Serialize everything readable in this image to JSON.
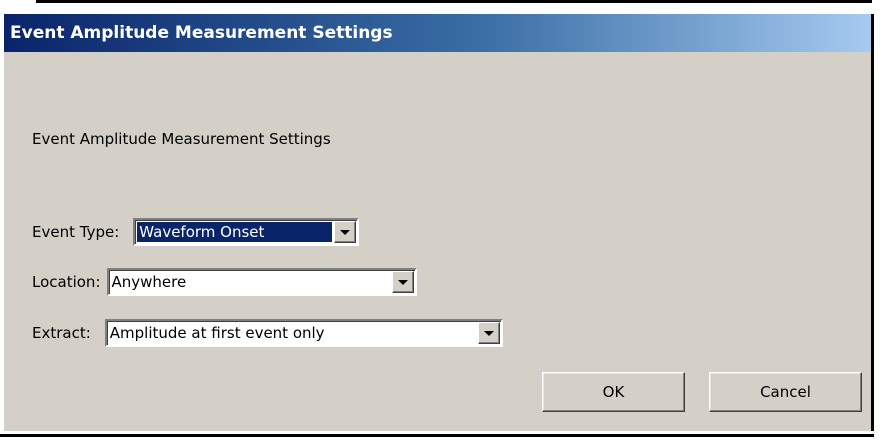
{
  "window": {
    "title": "Event Amplitude Measurement Settings"
  },
  "dialog": {
    "heading": "Event Amplitude Measurement Settings",
    "fields": [
      {
        "label": "Event Type:",
        "value": "Waveform Onset"
      },
      {
        "label": "Location:",
        "value": "Anywhere"
      },
      {
        "label": "Extract:",
        "value": "Amplitude at first event only"
      }
    ],
    "buttons": {
      "ok": "OK",
      "cancel": "Cancel"
    }
  },
  "colors": {
    "titlebar_start": "#0a246a",
    "titlebar_end": "#a6caf0",
    "dialog_bg": "#d4d0c8",
    "selection": "#0a246a"
  },
  "icons": {
    "dropdown": "chevron-down-icon"
  }
}
